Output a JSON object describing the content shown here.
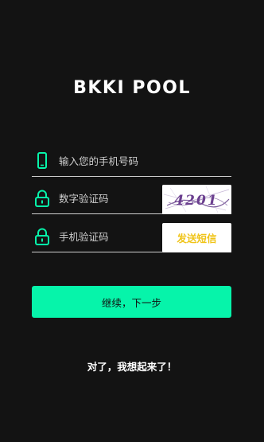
{
  "brand": {
    "logo_text": "BKKI POOL"
  },
  "form": {
    "phone": {
      "placeholder": "输入您的手机号码",
      "value": "",
      "icon": "phone-icon"
    },
    "captcha": {
      "placeholder": "数字验证码",
      "value": "",
      "icon": "lock-icon",
      "image_text": "4201"
    },
    "sms": {
      "placeholder": "手机验证码",
      "value": "",
      "icon": "lock-icon",
      "send_label": "发送短信"
    }
  },
  "actions": {
    "continue_label": "继续，下一步",
    "remember_label": "对了，我想起来了！"
  },
  "colors": {
    "background": "#131313",
    "accent": "#06f4aa",
    "sms_text": "#f0c419",
    "captcha_text": "#6b3f8f"
  }
}
